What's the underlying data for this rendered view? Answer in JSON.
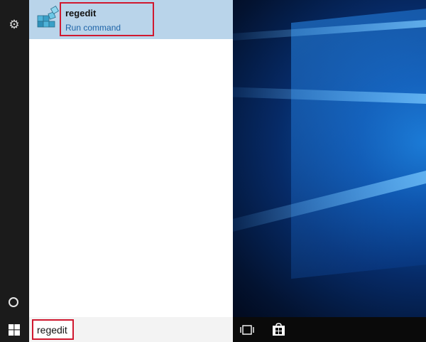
{
  "start_menu": {
    "result": {
      "title": "regedit",
      "subtitle": "Run command",
      "icon": "regedit-cubes-icon"
    },
    "search": {
      "value": "regedit"
    },
    "rail": {
      "settings_icon": "gear-icon",
      "cortana_icon": "cortana-circle-icon"
    }
  },
  "taskbar": {
    "start_icon": "windows-logo-icon",
    "task_view_icon": "task-view-icon",
    "store_icon": "store-icon"
  },
  "colors": {
    "selected_result": "#b9d4ea",
    "highlight_border": "#d0182f",
    "link_blue": "#1e64a8",
    "rail_bg": "#1b1b1b"
  }
}
